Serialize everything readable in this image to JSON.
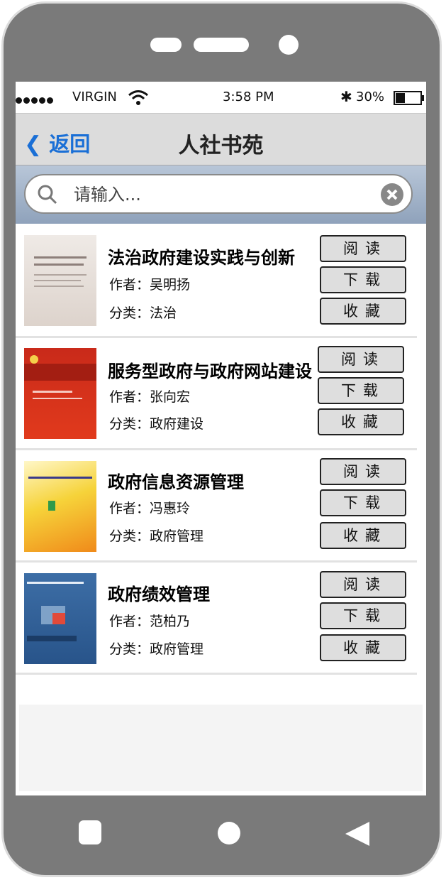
{
  "status": {
    "carrier": "VIRGIN",
    "time": "3:58 PM",
    "battery": "30%"
  },
  "nav": {
    "back_label": "返回",
    "title": "人社书苑"
  },
  "search": {
    "placeholder": "请输入..."
  },
  "actions": {
    "read": "阅读",
    "download": "下载",
    "favorite": "收藏"
  },
  "books": [
    {
      "title": "法治政府建设实践与创新",
      "author": "作者：吴明扬",
      "category": "分类：法治"
    },
    {
      "title": "服务型政府与政府网站建设",
      "author": "作者：张向宏",
      "category": "分类：政府建设"
    },
    {
      "title": "政府信息资源管理",
      "author": "作者：冯惠玲",
      "category": "分类：政府管理"
    },
    {
      "title": "政府绩效管理",
      "author": "作者：范柏乃",
      "category": "分类：政府管理"
    }
  ],
  "colors": {
    "accent": "#1a6fd6",
    "frame": "#7a7a7a"
  }
}
